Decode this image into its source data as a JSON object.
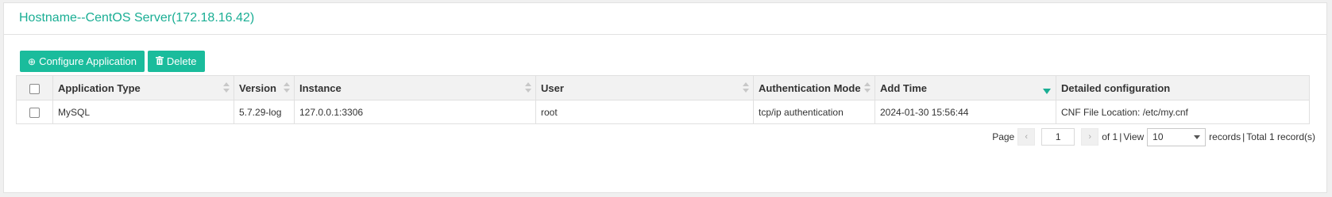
{
  "header": {
    "title": "Hostname--CentOS Server(172.18.16.42)"
  },
  "toolbar": {
    "configure_label": "Configure Application",
    "configure_icon": "plus-circle-icon",
    "delete_label": "Delete",
    "delete_icon": "trash-icon"
  },
  "table": {
    "columns": [
      {
        "label": "Application Type",
        "sortable": true
      },
      {
        "label": "Version",
        "sortable": true
      },
      {
        "label": "Instance",
        "sortable": true
      },
      {
        "label": "User",
        "sortable": true
      },
      {
        "label": "Authentication Mode",
        "sortable": true
      },
      {
        "label": "Add Time",
        "sortable": true,
        "sorted": "desc"
      },
      {
        "label": "Detailed configuration",
        "sortable": false
      }
    ],
    "rows": [
      {
        "app_type": "MySQL",
        "version": "5.7.29-log",
        "instance": "127.0.0.1:3306",
        "user": "root",
        "auth_mode": "tcp/ip authentication",
        "add_time": "2024-01-30 15:56:44",
        "detail": "CNF File Location: /etc/my.cnf"
      }
    ]
  },
  "pager": {
    "page_label": "Page",
    "current_page": "1",
    "of_label": "of 1",
    "sep": "|",
    "view_label": "View",
    "page_size": "10",
    "records_label": "records",
    "total_label": "Total 1 record(s)"
  },
  "colors": {
    "accent": "#1abc9c",
    "title": "#1aae94"
  }
}
